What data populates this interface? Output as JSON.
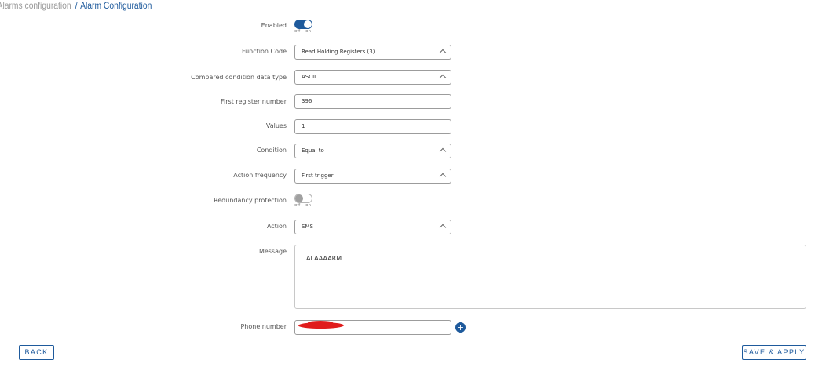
{
  "breadcrumb": {
    "parent": "Alarms configuration",
    "separator": "/",
    "current": "Alarm Configuration"
  },
  "toggle_text": {
    "off": "off",
    "on": "on"
  },
  "form": {
    "enabled": {
      "label": "Enabled",
      "state": "on"
    },
    "function_code": {
      "label": "Function Code",
      "value": "Read Holding Registers (3)"
    },
    "data_type": {
      "label": "Compared condition data type",
      "value": "ASCII"
    },
    "first_register": {
      "label": "First register number",
      "value": "396"
    },
    "values": {
      "label": "Values",
      "value": "1"
    },
    "condition": {
      "label": "Condition",
      "value": "Equal to"
    },
    "action_frequency": {
      "label": "Action frequency",
      "value": "First trigger"
    },
    "redundancy": {
      "label": "Redundancy protection",
      "state": "off"
    },
    "action": {
      "label": "Action",
      "value": "SMS"
    },
    "message": {
      "label": "Message",
      "value": "ALAAAARM"
    },
    "phone": {
      "label": "Phone number",
      "add_symbol": "+"
    }
  },
  "buttons": {
    "back": "BACK",
    "save_apply": "SAVE & APPLY"
  },
  "colors": {
    "accent": "#1e5a9c",
    "redaction": "#e01c1c"
  }
}
